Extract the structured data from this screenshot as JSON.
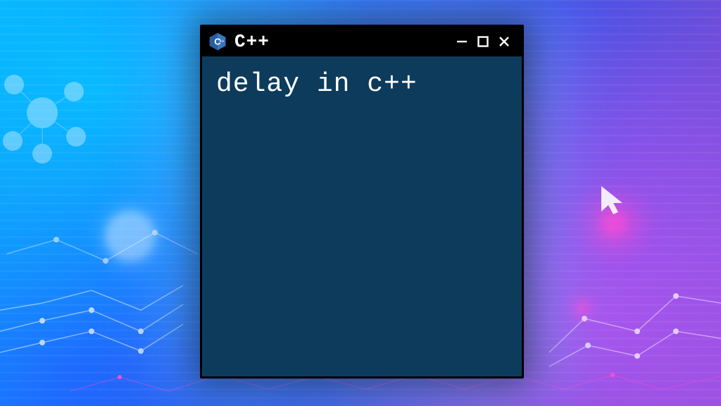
{
  "window": {
    "title": "C++",
    "controls": {
      "minimize": "minimize",
      "maximize": "maximize",
      "close": "close"
    },
    "logo_name": "cpp-logo"
  },
  "content": {
    "text": "delay in c++"
  },
  "colors": {
    "window_bg": "#0d3b5c",
    "titlebar_bg": "#000000",
    "text": "#ffffff",
    "accent_pink": "#ff49d6"
  }
}
